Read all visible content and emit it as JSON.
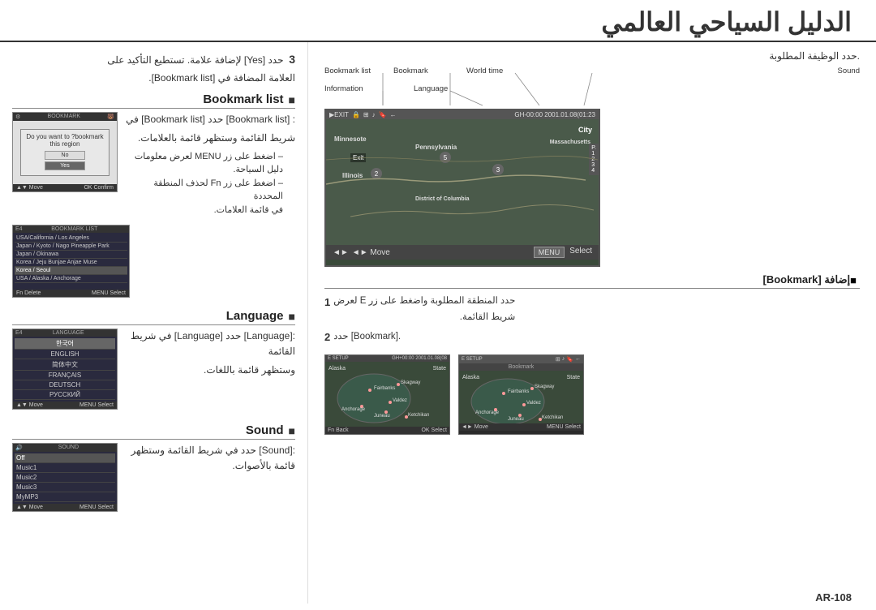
{
  "header": {
    "title": "الدليل السياحي العالمي"
  },
  "page_number": "AR-108",
  "step3": {
    "label": "3",
    "text1": "حدد [Yes] لإضافة علامة. تستطيع التأكيد على",
    "text2": "العلامة المضافة في [Bookmark list]."
  },
  "sections": {
    "bookmark_list": {
      "title": "Bookmark list",
      "bullet": "■",
      "text1": ": [Bookmark list] حدد [Bookmark list] في",
      "text2": "شريط القائمة وستظهر قائمة بالعلامات.",
      "dash1": "– اضغط على زر MENU لعرض معلومات",
      "dash1b": "دليل السياحة.",
      "dash2": "– اضغط على زر Fn لحذف المنطقة المحددة",
      "dash2b": "في قائمة العلامات."
    },
    "language": {
      "title": "Language",
      "bullet": "■",
      "text1": ":[Language] حدد [Language] في شريط القائمة",
      "text2": "وستظهر قائمة باللغات."
    },
    "sound": {
      "title": "Sound",
      "bullet": "■",
      "text1": ":[Sound] حدد في شريط القائمة وستظهر قائمة بالأصوات."
    }
  },
  "screens": {
    "bookmark_dialog": {
      "title_bar": "BOOKMARK",
      "dialog_text": "Do you want to ?bookmark this region",
      "btn_no": "No",
      "btn_yes": "Yes",
      "footer_left": "▲▼ Move",
      "footer_right": "OK  Confirm"
    },
    "bookmark_list": {
      "title_bar": "BOOKMARK LIST",
      "items": [
        "USA/California / Los Angeles",
        "Japan / Kyoto / Nago Pineapple Park",
        "Japan / Okinawa",
        "Korea / Jeju / Jeju Bunjae Anjae Muse",
        "Korea / Seoul",
        "USA / Alaska / Anchorage"
      ],
      "footer_fn": "Fn  Delete",
      "footer_menu": "MENU  Select"
    },
    "language": {
      "title_bar": "LANGUAGE",
      "items": [
        "한국어",
        "ENGLISH",
        "简体中文",
        "FRANÇAIS",
        "DEUTSCH",
        "РУССКИЙ"
      ],
      "footer_left": "▲▼ Move",
      "footer_menu": "MENU  Select"
    },
    "sound": {
      "title_bar": "SOUND",
      "items": [
        "Off",
        "Music1",
        "Music2",
        "Music3",
        "MyMP3"
      ],
      "footer_left": "▲▼ Move",
      "footer_menu": "MENU  Select"
    }
  },
  "nav_labels": {
    "bookmark": "Bookmark",
    "bookmark_list": "Bookmark list",
    "world_time": "World time",
    "information": "Information",
    "language": "Language",
    "sound": "Sound"
  },
  "map_screen": {
    "toolbar_left": "EXIT",
    "toolbar_time": "GH-00:00 2001.01.08(01:23",
    "states": {
      "minnesota": "Minnesote",
      "pennsylvania": "Pennsylvania",
      "massachusetts": "Massachusetts",
      "illinois": "Illinois",
      "district": "District of Columbia",
      "city": "City",
      "exit": "Exit"
    },
    "footer_left": "◄► Move",
    "footer_menu": "MENU",
    "footer_select": "Select",
    "page_nums": "P.\n1\n2\n3\n4"
  },
  "bookmark_addition": {
    "title": "إضافة [Bookmark]",
    "bullet": "■",
    "step1_num": "1",
    "step1_text": "حدد المنطقة المطلوبة واضغط على زر E لعرض",
    "step1_text2": "شريط القائمة.",
    "step2_num": "2",
    "step2_text": ".[Bookmark] حدد"
  },
  "small_maps": {
    "map1": {
      "toolbar": "E SETUP    GH+00:00 2001.01.08(08",
      "region": "Alaska",
      "state": "State",
      "cities": [
        "Fairbanks",
        "Skagway",
        "Valdez",
        "Juneau",
        "Anchorage",
        "Ketchikan"
      ],
      "footer_fn": "Fn  Back",
      "footer_ok": "OK  Select"
    },
    "map2": {
      "toolbar": "E SETUP    GH+00:00 2001.01.08(08",
      "region": "Alaska",
      "state": "State",
      "nav_labels": "Bookmark",
      "cities": [
        "Fairbanks",
        "Skagway",
        "Valdez",
        "Juneau",
        "Anchorage",
        "Ketchikan"
      ],
      "footer_move": "◄► Move",
      "footer_menu": "MENU  Select"
    }
  }
}
